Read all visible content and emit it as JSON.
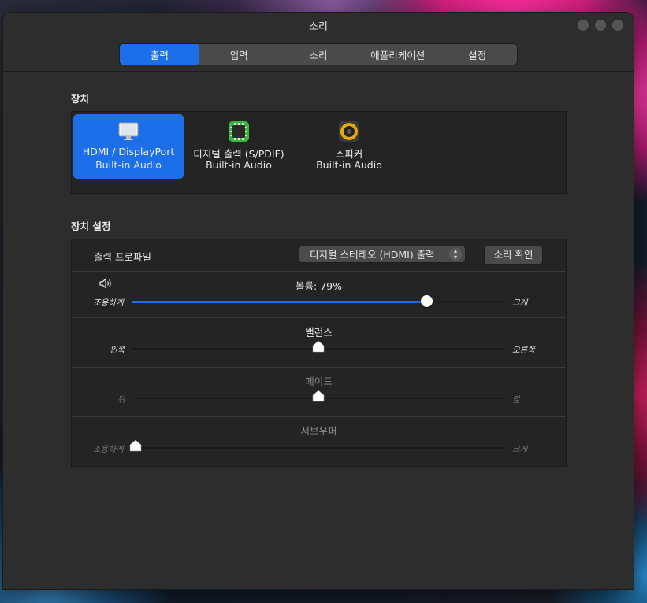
{
  "window": {
    "title": "소리"
  },
  "tabs": [
    {
      "label": "출력",
      "active": true
    },
    {
      "label": "입력",
      "active": false
    },
    {
      "label": "소리",
      "active": false
    },
    {
      "label": "애플리케이션",
      "active": false
    },
    {
      "label": "설정",
      "active": false
    }
  ],
  "devices_section": {
    "label": "장치",
    "items": [
      {
        "name": "HDMI / DisplayPort",
        "sub": "Built-in Audio",
        "icon": "monitor-icon",
        "selected": true
      },
      {
        "name": "디지털 출력 (S/PDIF)",
        "sub": "Built-in Audio",
        "icon": "chip-icon",
        "selected": false
      },
      {
        "name": "스피커",
        "sub": "Built-in Audio",
        "icon": "speaker-icon",
        "selected": false
      }
    ]
  },
  "settings_section": {
    "label": "장치 설정",
    "profile_label": "출력 프로파일",
    "profile_value": "디지털 스테레오 (HDMI) 출력",
    "test_button": "소리 확인",
    "volume": {
      "title": "볼륨: 79%",
      "value": 0.79,
      "left": "조용하게",
      "right": "크게",
      "icon": "volume-icon"
    },
    "balance": {
      "title": "밸런스",
      "value": 0.5,
      "left": "왼쪽",
      "right": "오른쪽"
    },
    "fade": {
      "title": "페이드",
      "value": 0.5,
      "left": "뒤",
      "right": "앞"
    },
    "subwoofer": {
      "title": "서브우퍼",
      "value": 0.0,
      "left": "조용하게",
      "right": "크게"
    }
  },
  "colors": {
    "accent": "#1c6fe8",
    "window_bg": "#2d2d2d",
    "panel_bg": "#242424"
  }
}
